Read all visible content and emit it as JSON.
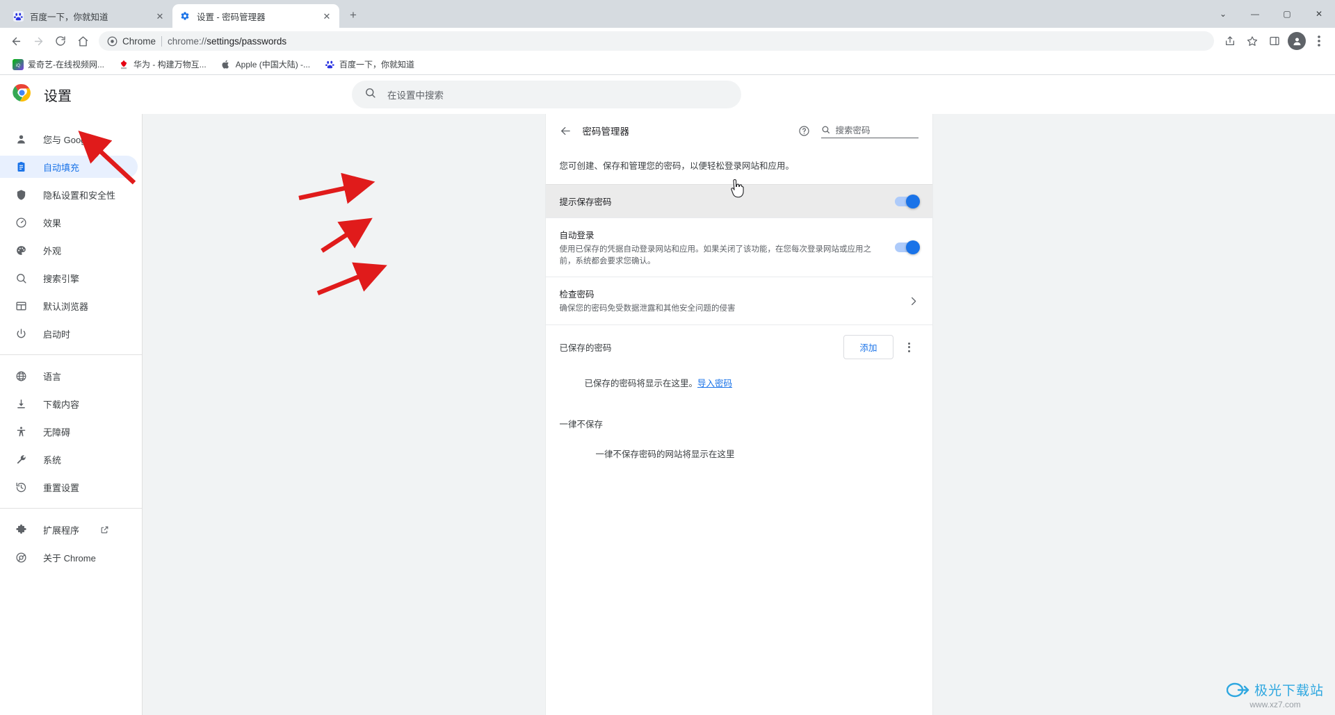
{
  "window": {
    "controls": {
      "chevron": "⌄",
      "minimize": "—",
      "maximize": "▢",
      "close": "✕"
    }
  },
  "tabs": [
    {
      "title": "百度一下，你就知道",
      "favicon": "baidu-icon",
      "active": false,
      "close": "✕"
    },
    {
      "title": "设置 - 密码管理器",
      "favicon": "settings-gear-icon",
      "active": true,
      "close": "✕"
    }
  ],
  "newtab_label": "+",
  "toolbar": {
    "back": "←",
    "forward": "→",
    "reload": "⟳",
    "home": "⌂",
    "omnibox_chip": "Chrome",
    "url_prefix": "chrome://",
    "url_main": "settings/passwords",
    "share_icon": "share-icon",
    "bookmark_icon": "star-icon",
    "sidepanel_icon": "side-panel-icon",
    "profile_icon": "profile-avatar-icon",
    "menu_icon": "three-dot-menu-icon"
  },
  "bookmarks": [
    {
      "label": "爱奇艺-在线视频网...",
      "icon": "iqiyi-icon"
    },
    {
      "label": "华为 - 构建万物互...",
      "icon": "huawei-icon"
    },
    {
      "label": "Apple (中国大陆) -...",
      "icon": "apple-icon"
    },
    {
      "label": "百度一下，你就知道",
      "icon": "baidu-icon"
    }
  ],
  "settings": {
    "brand_title": "设置",
    "search_placeholder": "在设置中搜索",
    "nav_groups": [
      {
        "items": [
          {
            "label": "您与 Google",
            "icon": "person-icon",
            "selected": false
          },
          {
            "label": "自动填充",
            "icon": "autofill-icon",
            "selected": true
          },
          {
            "label": "隐私设置和安全性",
            "icon": "shield-icon",
            "selected": false
          },
          {
            "label": "效果",
            "icon": "performance-icon",
            "selected": false
          },
          {
            "label": "外观",
            "icon": "palette-icon",
            "selected": false
          },
          {
            "label": "搜索引擎",
            "icon": "search-icon",
            "selected": false
          },
          {
            "label": "默认浏览器",
            "icon": "browser-icon",
            "selected": false
          },
          {
            "label": "启动时",
            "icon": "power-icon",
            "selected": false
          }
        ]
      },
      {
        "items": [
          {
            "label": "语言",
            "icon": "globe-icon",
            "selected": false
          },
          {
            "label": "下载内容",
            "icon": "download-icon",
            "selected": false
          },
          {
            "label": "无障碍",
            "icon": "accessibility-icon",
            "selected": false
          },
          {
            "label": "系统",
            "icon": "wrench-icon",
            "selected": false
          },
          {
            "label": "重置设置",
            "icon": "restore-icon",
            "selected": false
          }
        ]
      },
      {
        "items": [
          {
            "label": "扩展程序",
            "icon": "puzzle-icon",
            "selected": false,
            "external": true
          },
          {
            "label": "关于 Chrome",
            "icon": "chrome-icon",
            "selected": false
          }
        ]
      }
    ]
  },
  "password_manager": {
    "back_icon": "back-arrow-icon",
    "title": "密码管理器",
    "help_icon": "help-circle-icon",
    "search_icon": "search-icon",
    "search_placeholder": "搜索密码",
    "intro": "您可创建、保存和管理您的密码，以便轻松登录网站和应用。",
    "rows": [
      {
        "title": "提示保存密码",
        "sub": "",
        "control": "toggle",
        "toggle_on": true,
        "hovered": true
      },
      {
        "title": "自动登录",
        "sub": "使用已保存的凭据自动登录网站和应用。如果关闭了该功能，在您每次登录网站或应用之前，系统都会要求您确认。",
        "control": "toggle",
        "toggle_on": true,
        "hovered": false
      },
      {
        "title": "检查密码",
        "sub": "确保您的密码免受数据泄露和其他安全问题的侵害",
        "control": "chevron",
        "toggle_on": false,
        "hovered": false
      }
    ],
    "saved_section": {
      "label": "已保存的密码",
      "add_button": "添加",
      "menu_icon": "three-dot-menu-icon",
      "empty_text": "已保存的密码将显示在这里。",
      "empty_link": "导入密码"
    },
    "never_section": {
      "label": "一律不保存",
      "empty_text": "一律不保存密码的网站将显示在这里"
    }
  },
  "annotations": {
    "arrow_color": "#e01b1b",
    "arrows": [
      {
        "name": "arrow-to-autofill"
      },
      {
        "name": "arrow-to-offer-save-passwords"
      },
      {
        "name": "arrow-to-auto-signin"
      },
      {
        "name": "arrow-to-check-passwords"
      }
    ],
    "cursor": "hand-pointer-cursor"
  },
  "watermark": {
    "text": "极光下载站",
    "sub": "www.xz7.com",
    "color": "#2ea7e0"
  }
}
